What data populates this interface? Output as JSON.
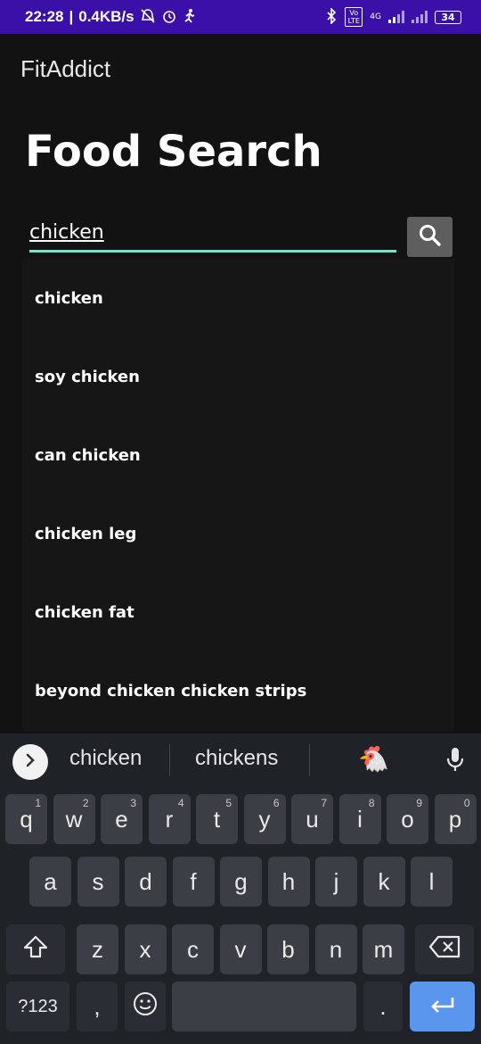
{
  "status_bar": {
    "time": "22:28",
    "network_speed": "0.4KB/s",
    "battery": "34",
    "network_label": "4G",
    "volte_label": "Vo LTE"
  },
  "app": {
    "title": "FitAddict"
  },
  "page": {
    "title": "Food Search"
  },
  "search": {
    "value": "chicken",
    "button_icon": "search-icon"
  },
  "suggestions": [
    "chicken",
    "soy chicken",
    "can chicken",
    "chicken leg",
    "chicken fat",
    "beyond chicken chicken strips"
  ],
  "keyboard": {
    "suggestion_1": "chicken",
    "suggestion_2": "chickens",
    "suggestion_emoji": "🐔",
    "row1": [
      {
        "label": "q",
        "hint": "1"
      },
      {
        "label": "w",
        "hint": "2"
      },
      {
        "label": "e",
        "hint": "3"
      },
      {
        "label": "r",
        "hint": "4"
      },
      {
        "label": "t",
        "hint": "5"
      },
      {
        "label": "y",
        "hint": "6"
      },
      {
        "label": "u",
        "hint": "7"
      },
      {
        "label": "i",
        "hint": "8"
      },
      {
        "label": "o",
        "hint": "9"
      },
      {
        "label": "p",
        "hint": "0"
      }
    ],
    "row2": [
      "a",
      "s",
      "d",
      "f",
      "g",
      "h",
      "j",
      "k",
      "l"
    ],
    "row3": [
      "z",
      "x",
      "c",
      "v",
      "b",
      "n",
      "m"
    ],
    "symbols_label": "?123",
    "comma_label": ",",
    "period_label": "."
  },
  "colors": {
    "status_bar": "#3a10a8",
    "background": "#121212",
    "input_underline": "#74e3c8",
    "enter_key": "#5a96ee"
  }
}
